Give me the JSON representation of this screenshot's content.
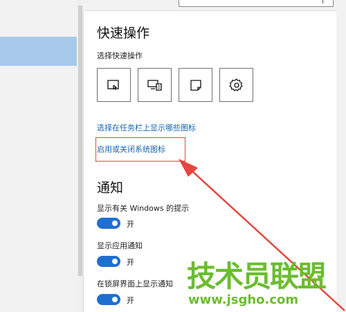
{
  "quick_actions": {
    "title": "快速操作",
    "subtitle": "选择快速操作",
    "tiles": [
      {
        "icon": "tablet-mode-icon"
      },
      {
        "icon": "project-icon"
      },
      {
        "icon": "note-icon"
      },
      {
        "icon": "gear-icon"
      }
    ]
  },
  "taskbar_links": {
    "choose_icons": "选择在任务栏上显示哪些图标",
    "toggle_system_icons": "启用或关闭系统图标"
  },
  "notifications": {
    "title": "通知",
    "items": [
      {
        "label": "显示有关 Windows 的提示",
        "state": "开"
      },
      {
        "label": "显示应用通知",
        "state": "开"
      },
      {
        "label": "在锁屏界面上显示通知",
        "state": "开"
      }
    ]
  },
  "watermark": {
    "main": "技术员联盟",
    "url": "www.jsgho.com"
  },
  "colors": {
    "accent": "#1f6fd0",
    "link": "#1464b4",
    "highlight_box": "#e4463e",
    "watermark": "#6bbd2f",
    "nav_selected": "#a8c9ea"
  }
}
